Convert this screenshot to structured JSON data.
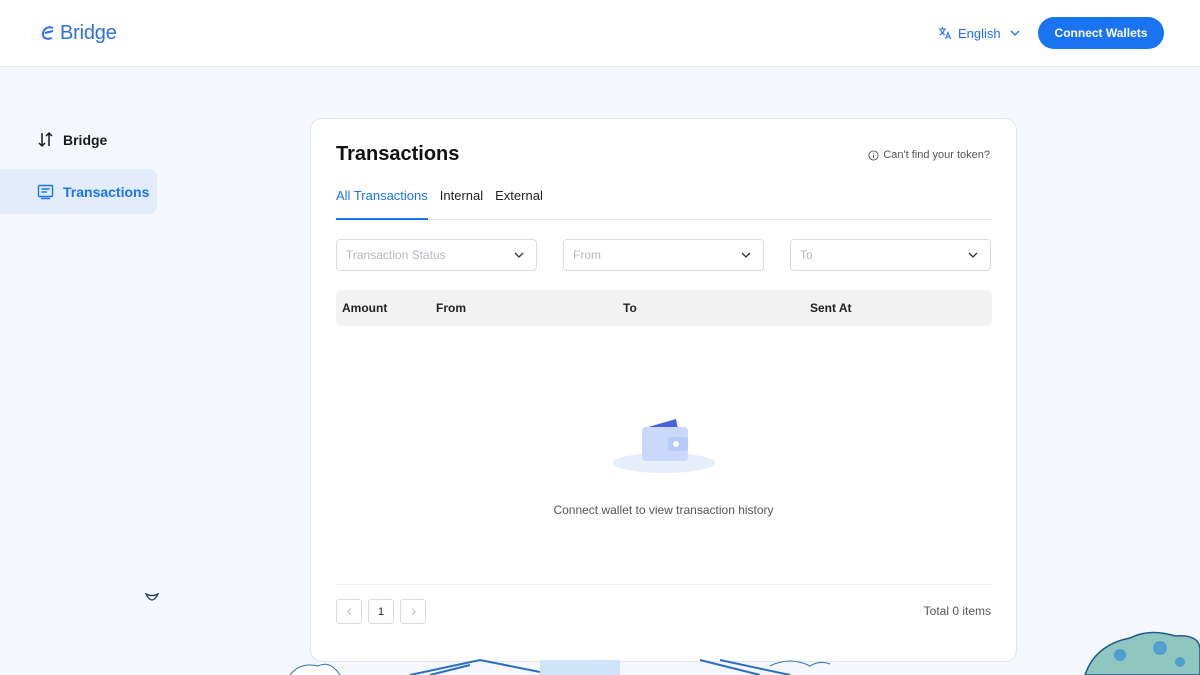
{
  "header": {
    "logo_text": "Bridge",
    "language": "English",
    "connect_label": "Connect Wallets"
  },
  "sidebar": {
    "items": [
      {
        "label": "Bridge",
        "icon": "swap-vertical-icon"
      },
      {
        "label": "Transactions",
        "icon": "receipt-icon",
        "active": true
      }
    ]
  },
  "card": {
    "title": "Transactions",
    "help_text": "Can't find your token?",
    "tabs": [
      {
        "label": "All Transactions",
        "active": true
      },
      {
        "label": "Internal"
      },
      {
        "label": "External"
      }
    ],
    "filters": [
      {
        "placeholder": "Transaction Status"
      },
      {
        "placeholder": "From"
      },
      {
        "placeholder": "To"
      }
    ],
    "columns": [
      "Amount",
      "From",
      "To",
      "Sent At"
    ],
    "empty_text": "Connect wallet to view transaction history",
    "pagination": {
      "current_page": "1",
      "total_text": "Total 0 items"
    }
  },
  "colors": {
    "accent": "#1a73f0",
    "active_bg": "#e3ecfa",
    "page_bg": "#f4f8fc"
  }
}
